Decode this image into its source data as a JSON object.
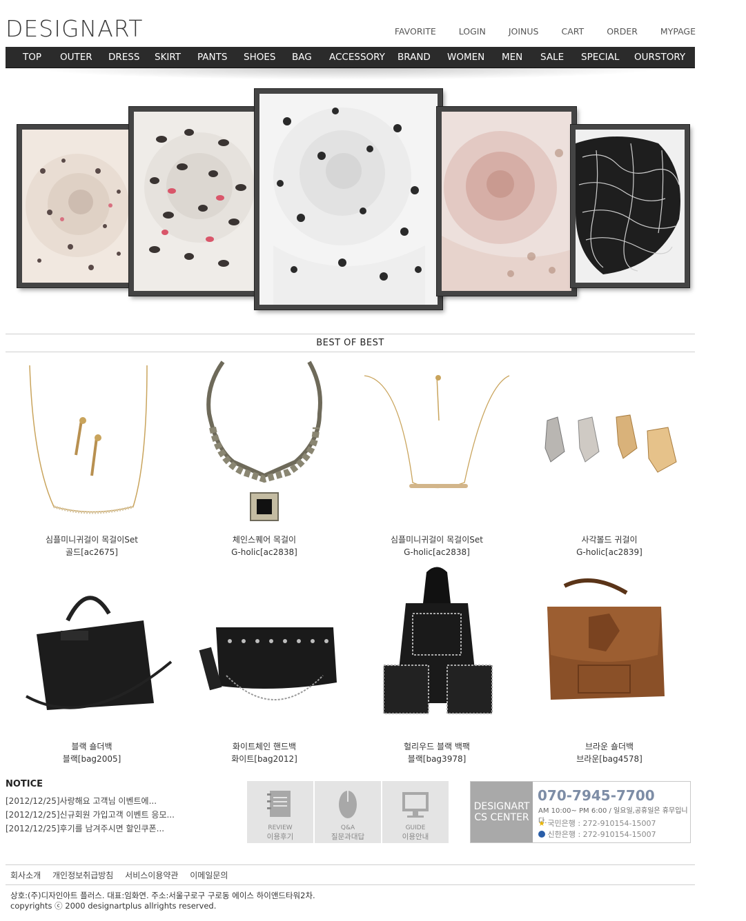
{
  "logo": "DESIGNART",
  "top_nav": [
    "FAVORITE",
    "LOGIN",
    "JOINUS",
    "CART",
    "ORDER",
    "MYPAGE"
  ],
  "menu": [
    "TOP",
    "OUTER",
    "DRESS",
    "SKIRT",
    "PANTS",
    "SHOES",
    "BAG",
    "ACCESSORY",
    "BRAND",
    "WOMEN",
    "MEN",
    "SALE",
    "SPECIAL",
    "OURSTORY"
  ],
  "section_title": "BEST OF BEST",
  "products": [
    {
      "name": "심플미니귀걸이 목걸이Set",
      "sub": "골드[ac2675]"
    },
    {
      "name": "체인스퀘어 목걸이",
      "sub": "G-holic[ac2838]"
    },
    {
      "name": "심플미니귀걸이 목걸이Set",
      "sub": "G-holic[ac2838]"
    },
    {
      "name": "사각볼드 귀걸이",
      "sub": "G-holic[ac2839]"
    },
    {
      "name": "블랙 숄더백",
      "sub": "블랙[bag2005]"
    },
    {
      "name": "화이트체인 핸드백",
      "sub": "화이트[bag2012]"
    },
    {
      "name": "헐리우드 블랙 백팩",
      "sub": "블랙[bag3978]"
    },
    {
      "name": "브라운 숄더백",
      "sub": "브라운[bag4578]"
    }
  ],
  "notice": {
    "title": "NOTICE",
    "items": [
      "[2012/12/25]사랑해요 고객님 이벤트에...",
      "[2012/12/25]신규회원 가입고객 이벤트 응모...",
      "[2012/12/25]후기를 남겨주시면 할인쿠폰..."
    ]
  },
  "services": [
    {
      "en": "REVIEW",
      "ko": "이용후기",
      "icon": "notebook-icon"
    },
    {
      "en": "Q&A",
      "ko": "질문과대답",
      "icon": "mouse-icon"
    },
    {
      "en": "GUIDE",
      "ko": "이용안내",
      "icon": "monitor-icon"
    }
  ],
  "cs": {
    "label_line1": "DESIGNART",
    "label_line2": "CS CENTER",
    "phone": "070-7945-7700",
    "hours": "AM 10:00~ PM 6:00 / 일요일,공휴일은 휴무입니다.",
    "bank1": "국민은행 : 272-910154-15007",
    "bank2": "신한은행 : 272-910154-15007"
  },
  "footer_links": [
    "회사소개",
    "개인정보취급방침",
    "서비스이용약관",
    "이메일문의"
  ],
  "footer_address": "상호:(주)디자인아트 플러스. 대표:임화연. 주소:서울구로구 구로동 에이스 하이앤드타워2차.",
  "copyright": "copyrights ⓒ 2000 designartplus allrights reserved."
}
